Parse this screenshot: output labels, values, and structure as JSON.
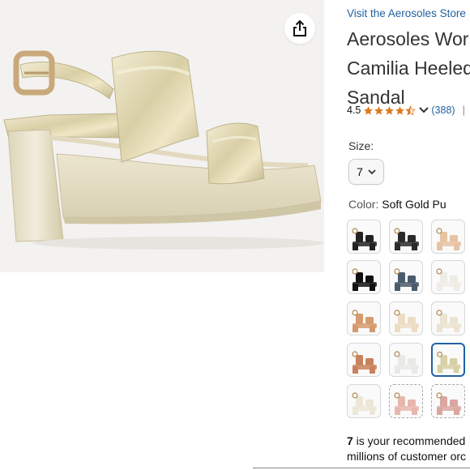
{
  "store_link": "Visit the Aerosoles Store",
  "title_lines": [
    "Aerosoles Wor",
    "Camilia Heeled",
    "Sandal"
  ],
  "rating": {
    "value": "4.5",
    "stars": 4.5,
    "count": "(388)",
    "separator": "|",
    "more": "S"
  },
  "size": {
    "label": "Size:",
    "selected": "7"
  },
  "color": {
    "label": "Color:",
    "selected": "Soft Gold Pu"
  },
  "swatches": [
    {
      "name": "black-1",
      "color": "#222222",
      "selected": false,
      "dashed": false
    },
    {
      "name": "black-2",
      "color": "#2a2a2a",
      "selected": false,
      "dashed": false
    },
    {
      "name": "nude",
      "color": "#e6c3a3",
      "selected": false,
      "dashed": false
    },
    {
      "name": "black-patent",
      "color": "#111111",
      "selected": false,
      "dashed": false
    },
    {
      "name": "denim",
      "color": "#4a5b6b",
      "selected": false,
      "dashed": false
    },
    {
      "name": "white",
      "color": "#efece6",
      "selected": false,
      "dashed": false
    },
    {
      "name": "tan",
      "color": "#d69a6e",
      "selected": false,
      "dashed": false
    },
    {
      "name": "cream",
      "color": "#ecdcc4",
      "selected": false,
      "dashed": false
    },
    {
      "name": "ivory",
      "color": "#ece4d2",
      "selected": false,
      "dashed": false
    },
    {
      "name": "cognac",
      "color": "#c9825b",
      "selected": false,
      "dashed": false
    },
    {
      "name": "silver-white",
      "color": "#e9e9e6",
      "selected": false,
      "dashed": false
    },
    {
      "name": "soft-gold",
      "color": "#d8cfa4",
      "selected": true,
      "dashed": false
    },
    {
      "name": "bone",
      "color": "#ece6d6",
      "selected": false,
      "dashed": false
    },
    {
      "name": "blush",
      "color": "#e7b7ae",
      "selected": false,
      "dashed": true
    },
    {
      "name": "rose",
      "color": "#d9a7a0",
      "selected": false,
      "dashed": true
    }
  ],
  "recommendation": {
    "size": "7",
    "line1_rest": " is your recommended",
    "line2": "millions of customer orc"
  },
  "colors": {
    "link": "#2162a1",
    "star": "#de7921",
    "selected_border": "#2162a1"
  }
}
